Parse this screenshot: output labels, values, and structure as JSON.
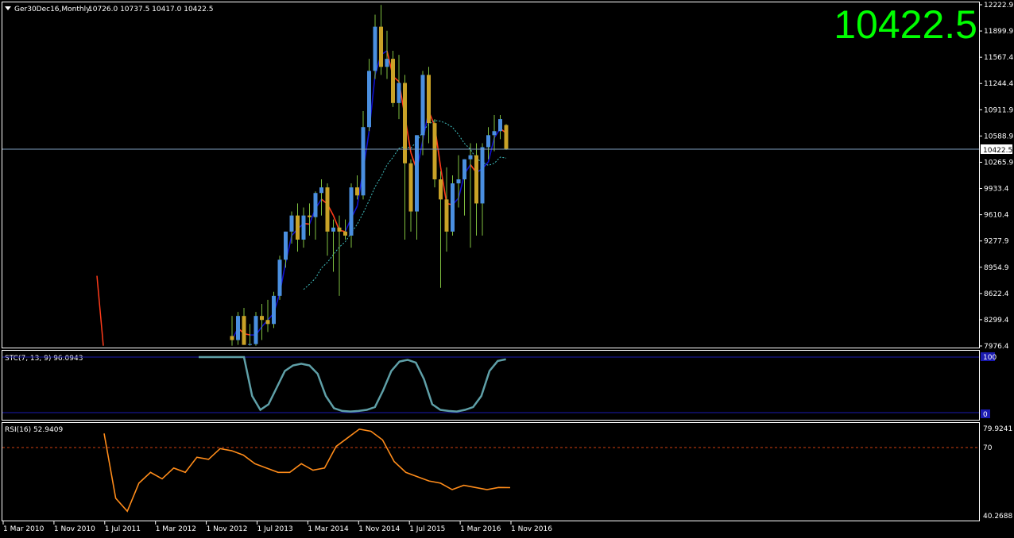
{
  "header": {
    "title": "Ger30Dec16,Monthly",
    "ohlc": "10726.0 10737.5 10417.0 10422.5",
    "big_price": "10422.5"
  },
  "colors": {
    "background": "#000000",
    "bull_body": "#4a8fe0",
    "bear_body": "#c9a227",
    "wick": "#7fbf3f",
    "ma_up": "#1010d0",
    "ma_down": "#ff3b1a",
    "ma_slow": "#40c0c0",
    "stc_line": "#5fa0a8",
    "stc_levels": "#1a1ab0",
    "rsi_line": "#ff8c1a",
    "rsi_level": "#d04010",
    "big_price": "#00ff00",
    "last_price_line": "#7f9fbf"
  },
  "price_axis": {
    "ticks": [
      "12222.9",
      "11899.9",
      "11567.4",
      "11244.4",
      "10911.9",
      "10588.9",
      "10265.9",
      "9933.4",
      "9610.4",
      "9277.9",
      "8954.9",
      "8622.4",
      "8299.4",
      "7976.4"
    ],
    "current_label": "10422.5"
  },
  "time_axis": {
    "labels": [
      "1 Mar 2010",
      "1 Nov 2010",
      "1 Jul 2011",
      "1 Mar 2012",
      "1 Nov 2012",
      "1 Jul 2013",
      "1 Mar 2014",
      "1 Nov 2014",
      "1 Jul 2015",
      "1 Mar 2016",
      "1 Nov 2016"
    ]
  },
  "stc_panel": {
    "label": "STC(7, 13, 9) 96.0943",
    "level_high": "100",
    "level_low": "0"
  },
  "rsi_panel": {
    "label": "RSI(16) 52.9409",
    "tick_top": "79.9241",
    "tick_level": "70",
    "tick_bottom": "40.2688"
  },
  "chart_data": {
    "type": "candlestick",
    "timeframe": "Monthly",
    "symbol": "Ger30Dec16",
    "ylim": [
      7976.4,
      12222.9
    ],
    "candles_from": "2012-11",
    "candles": [
      {
        "o": 8100,
        "h": 8350,
        "l": 7980,
        "c": 8050
      },
      {
        "o": 8050,
        "h": 8400,
        "l": 7990,
        "c": 8350
      },
      {
        "o": 8350,
        "h": 8450,
        "l": 7990,
        "c": 7990
      },
      {
        "o": 7990,
        "h": 8250,
        "l": 7980,
        "c": 8000
      },
      {
        "o": 8000,
        "h": 8400,
        "l": 7980,
        "c": 8350
      },
      {
        "o": 8350,
        "h": 8500,
        "l": 8050,
        "c": 8300
      },
      {
        "o": 8300,
        "h": 8550,
        "l": 8150,
        "c": 8250
      },
      {
        "o": 8250,
        "h": 8650,
        "l": 8200,
        "c": 8600
      },
      {
        "o": 8600,
        "h": 9100,
        "l": 8550,
        "c": 9050
      },
      {
        "o": 9050,
        "h": 9400,
        "l": 8950,
        "c": 9400
      },
      {
        "o": 9400,
        "h": 9650,
        "l": 9250,
        "c": 9600
      },
      {
        "o": 9600,
        "h": 9750,
        "l": 9150,
        "c": 9300
      },
      {
        "o": 9300,
        "h": 9700,
        "l": 9200,
        "c": 9600
      },
      {
        "o": 9600,
        "h": 9750,
        "l": 9350,
        "c": 9580
      },
      {
        "o": 9580,
        "h": 9900,
        "l": 9300,
        "c": 9880
      },
      {
        "o": 9880,
        "h": 10050,
        "l": 9600,
        "c": 9950
      },
      {
        "o": 9950,
        "h": 10000,
        "l": 9100,
        "c": 9400
      },
      {
        "o": 9400,
        "h": 9550,
        "l": 8900,
        "c": 9450
      },
      {
        "o": 9450,
        "h": 9600,
        "l": 8600,
        "c": 9400
      },
      {
        "o": 9400,
        "h": 9550,
        "l": 9300,
        "c": 9350
      },
      {
        "o": 9350,
        "h": 10000,
        "l": 9200,
        "c": 9950
      },
      {
        "o": 9950,
        "h": 10100,
        "l": 9800,
        "c": 9850
      },
      {
        "o": 9850,
        "h": 10900,
        "l": 9800,
        "c": 10700
      },
      {
        "o": 10700,
        "h": 11550,
        "l": 10650,
        "c": 11400
      },
      {
        "o": 11400,
        "h": 12100,
        "l": 11300,
        "c": 11950
      },
      {
        "o": 11950,
        "h": 12220,
        "l": 11350,
        "c": 11450
      },
      {
        "o": 11450,
        "h": 11900,
        "l": 11300,
        "c": 11550
      },
      {
        "o": 11550,
        "h": 11650,
        "l": 10950,
        "c": 11000
      },
      {
        "o": 11000,
        "h": 11600,
        "l": 10800,
        "c": 11250
      },
      {
        "o": 11250,
        "h": 11350,
        "l": 9300,
        "c": 10250
      },
      {
        "o": 10250,
        "h": 10300,
        "l": 9400,
        "c": 9650
      },
      {
        "o": 9650,
        "h": 10600,
        "l": 9300,
        "c": 10600
      },
      {
        "o": 10600,
        "h": 11400,
        "l": 10350,
        "c": 11350
      },
      {
        "o": 11350,
        "h": 11450,
        "l": 10500,
        "c": 10750
      },
      {
        "o": 10750,
        "h": 10800,
        "l": 9950,
        "c": 10050
      },
      {
        "o": 10050,
        "h": 10150,
        "l": 8700,
        "c": 9800
      },
      {
        "o": 9800,
        "h": 10200,
        "l": 9150,
        "c": 9400
      },
      {
        "o": 9400,
        "h": 10100,
        "l": 9350,
        "c": 10000
      },
      {
        "o": 10000,
        "h": 10350,
        "l": 9700,
        "c": 10050
      },
      {
        "o": 10050,
        "h": 10300,
        "l": 9600,
        "c": 10300
      },
      {
        "o": 10300,
        "h": 10500,
        "l": 9200,
        "c": 10350
      },
      {
        "o": 10350,
        "h": 10500,
        "l": 9350,
        "c": 9750
      },
      {
        "o": 9750,
        "h": 10500,
        "l": 9350,
        "c": 10450
      },
      {
        "o": 10450,
        "h": 10700,
        "l": 10300,
        "c": 10600
      },
      {
        "o": 10600,
        "h": 10850,
        "l": 10400,
        "c": 10650
      },
      {
        "o": 10650,
        "h": 10850,
        "l": 10550,
        "c": 10800
      },
      {
        "o": 10726.0,
        "h": 10737.5,
        "l": 10417.0,
        "c": 10422.5
      }
    ],
    "stc": [
      100,
      100,
      100,
      30,
      5,
      15,
      45,
      75,
      85,
      88,
      85,
      70,
      30,
      8,
      3,
      2,
      3,
      5,
      10,
      40,
      75,
      92,
      95,
      90,
      60,
      15,
      5,
      3,
      2,
      5,
      10,
      30,
      75,
      93,
      96.09
    ],
    "rsi": [
      78,
      48,
      42,
      55,
      60,
      57,
      62,
      60,
      67,
      66,
      71,
      70,
      68,
      64,
      62,
      60,
      60,
      64,
      61,
      62,
      72,
      76,
      80,
      79,
      75,
      65,
      60,
      58,
      56,
      55,
      52,
      54,
      53,
      52,
      53,
      52.94
    ]
  }
}
